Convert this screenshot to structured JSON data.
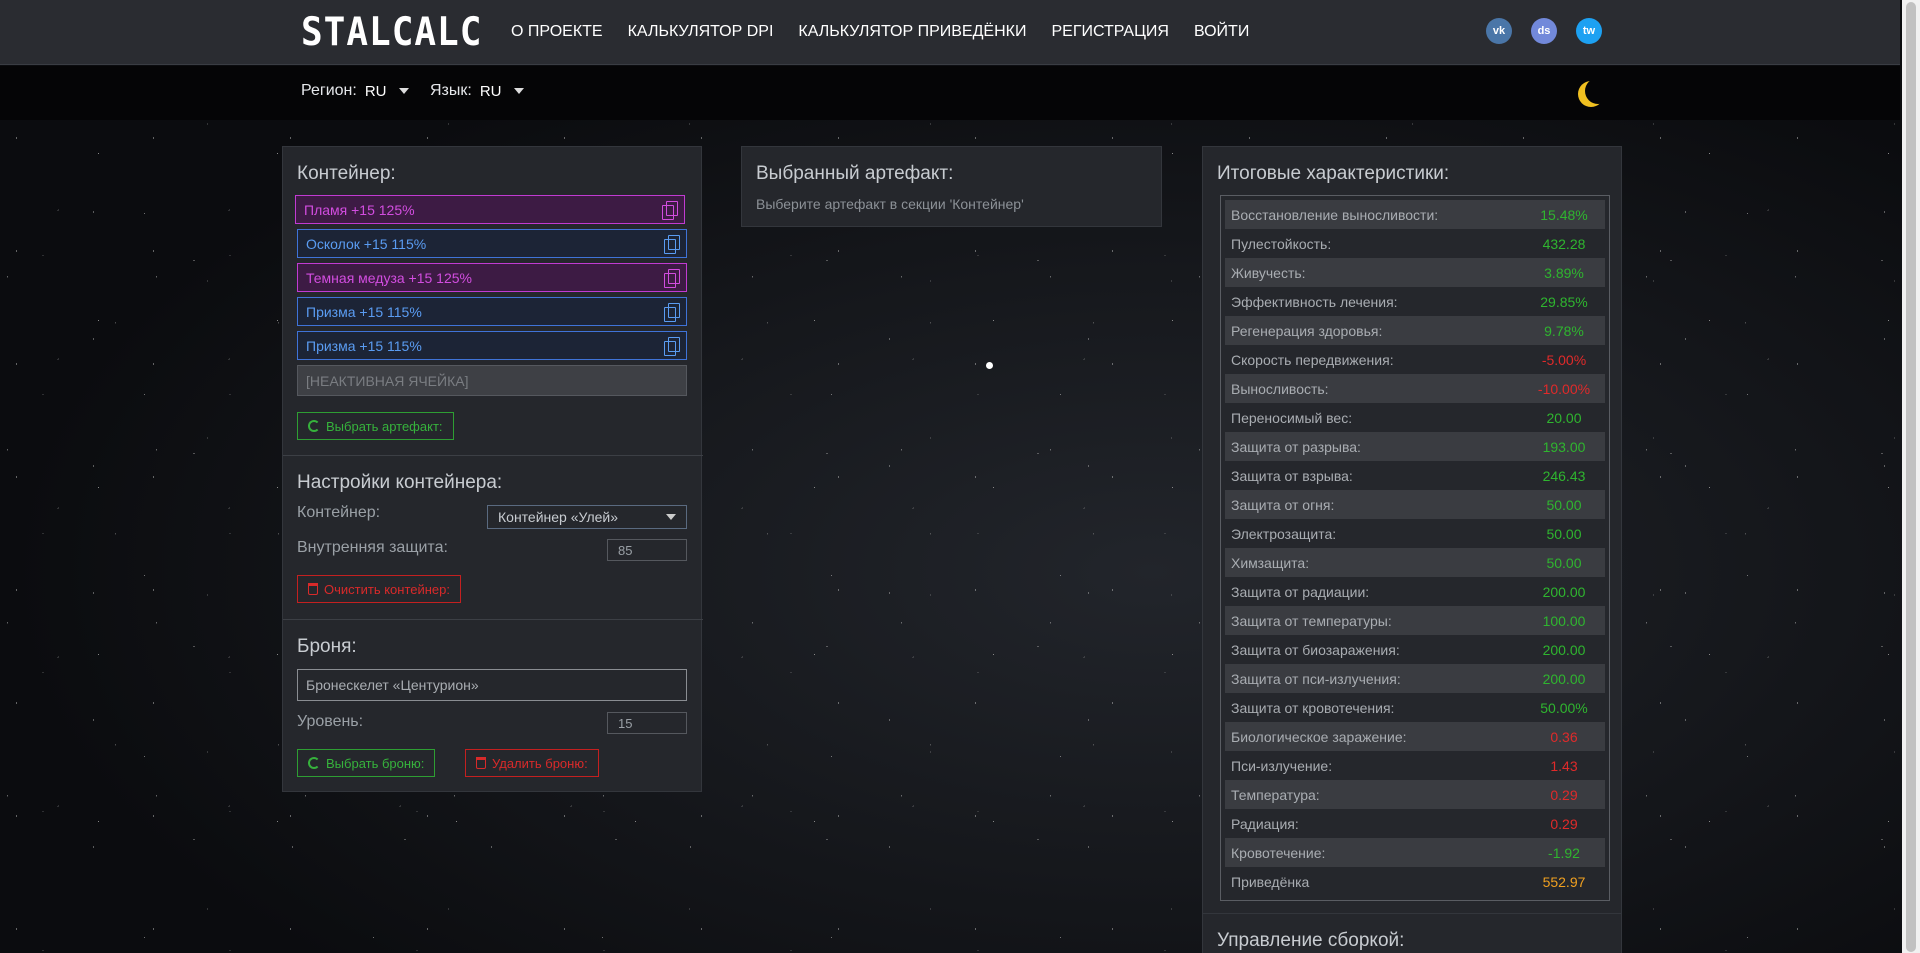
{
  "brand": "STALCALC",
  "nav": [
    "О ПРОЕКТЕ",
    "КАЛЬКУЛЯТОР DPI",
    "КАЛЬКУЛЯТОР ПРИВЕДЁНКИ",
    "РЕГИСТРАЦИЯ",
    "ВОЙТИ"
  ],
  "socials": {
    "vk": "vk",
    "discord": "ds",
    "twitter": "tw"
  },
  "subbar": {
    "region_label": "Регион:",
    "region_value": "RU",
    "lang_label": "Язык:",
    "lang_value": "RU"
  },
  "container": {
    "title": "Контейнер:",
    "slots": [
      {
        "label": "Пламя +15 125%",
        "type": "purple"
      },
      {
        "label": "Осколок +15 115%",
        "type": "blue"
      },
      {
        "label": "Темная медуза +15 125%",
        "type": "purple"
      },
      {
        "label": "Призма +15 115%",
        "type": "blue"
      },
      {
        "label": "Призма +15 115%",
        "type": "blue"
      },
      {
        "label": "[НЕАКТИВНАЯ ЯЧЕЙКА]",
        "type": "inactive"
      }
    ],
    "choose_artifact": "Выбрать артефакт:"
  },
  "container_settings": {
    "title": "Настройки контейнера:",
    "container_label": "Контейнер:",
    "container_value": "Контейнер «Улей»",
    "inner_protection_label": "Внутренняя защита:",
    "inner_protection_value": "85",
    "clear_button": "Очистить контейнер:"
  },
  "armor": {
    "title": "Броня:",
    "armor_value": "Бронескелет «Центурион»",
    "level_label": "Уровень:",
    "level_value": "15",
    "choose_button": "Выбрать броню:",
    "delete_button": "Удалить броню:"
  },
  "selected_artifact": {
    "title": "Выбранный артефакт:",
    "hint": "Выберите артефакт в секции 'Контейнер'"
  },
  "stats": {
    "title": "Итоговые характеристики:",
    "rows": [
      {
        "name": "Восстановление выносливости:",
        "value": "15.48%",
        "color": "green"
      },
      {
        "name": "Пулестойкость:",
        "value": "432.28",
        "color": "green"
      },
      {
        "name": "Живучесть:",
        "value": "3.89%",
        "color": "green"
      },
      {
        "name": "Эффективность лечения:",
        "value": "29.85%",
        "color": "green"
      },
      {
        "name": "Регенерация здоровья:",
        "value": "9.78%",
        "color": "green"
      },
      {
        "name": "Скорость передвижения:",
        "value": "-5.00%",
        "color": "red"
      },
      {
        "name": "Выносливость:",
        "value": "-10.00%",
        "color": "red"
      },
      {
        "name": "Переносимый вес:",
        "value": "20.00",
        "color": "green"
      },
      {
        "name": "Защита от разрыва:",
        "value": "193.00",
        "color": "green"
      },
      {
        "name": "Защита от взрыва:",
        "value": "246.43",
        "color": "green"
      },
      {
        "name": "Защита от огня:",
        "value": "50.00",
        "color": "green"
      },
      {
        "name": "Электрозащита:",
        "value": "50.00",
        "color": "green"
      },
      {
        "name": "Химзащита:",
        "value": "50.00",
        "color": "green"
      },
      {
        "name": "Защита от радиации:",
        "value": "200.00",
        "color": "green"
      },
      {
        "name": "Защита от температуры:",
        "value": "100.00",
        "color": "green"
      },
      {
        "name": "Защита от биозаражения:",
        "value": "200.00",
        "color": "green"
      },
      {
        "name": "Защита от пси-излучения:",
        "value": "200.00",
        "color": "green"
      },
      {
        "name": "Защита от кровотечения:",
        "value": "50.00%",
        "color": "green"
      },
      {
        "name": "Биологическое заражение:",
        "value": "0.36",
        "color": "red"
      },
      {
        "name": "Пси-излучение:",
        "value": "1.43",
        "color": "red"
      },
      {
        "name": "Температура:",
        "value": "0.29",
        "color": "red"
      },
      {
        "name": "Радиация:",
        "value": "0.29",
        "color": "red"
      },
      {
        "name": "Кровотечение:",
        "value": "-1.92",
        "color": "green"
      },
      {
        "name": "Приведёнка",
        "value": "552.97",
        "color": "orange"
      }
    ]
  },
  "build_management": {
    "title": "Управление сборкой:"
  }
}
